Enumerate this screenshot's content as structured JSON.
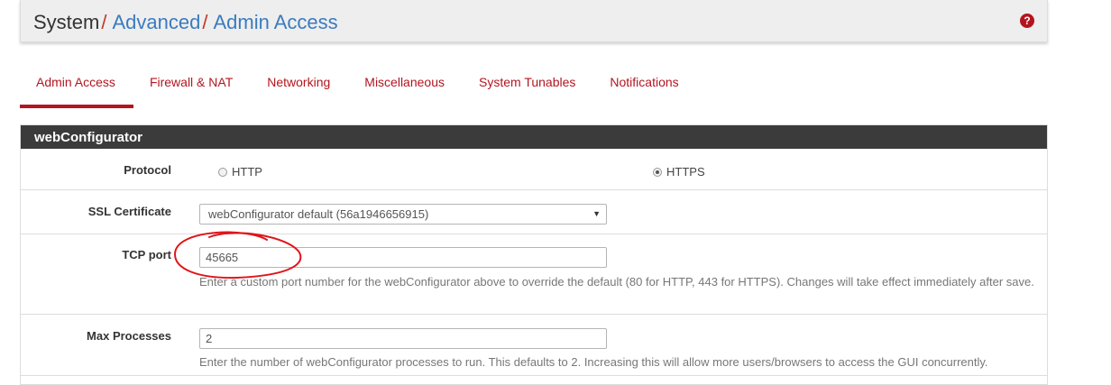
{
  "breadcrumb": {
    "system": "System",
    "advanced": "Advanced",
    "admin_access": "Admin Access",
    "separator": "/"
  },
  "help_icon": {
    "glyph": "?",
    "color": "#b3151f"
  },
  "tabs": [
    {
      "label": "Admin Access",
      "active": true
    },
    {
      "label": "Firewall & NAT",
      "active": false
    },
    {
      "label": "Networking",
      "active": false
    },
    {
      "label": "Miscellaneous",
      "active": false
    },
    {
      "label": "System Tunables",
      "active": false
    },
    {
      "label": "Notifications",
      "active": false
    }
  ],
  "panel": {
    "title": "webConfigurator",
    "protocol": {
      "label": "Protocol",
      "options": [
        {
          "label": "HTTP",
          "checked": false
        },
        {
          "label": "HTTPS",
          "checked": true
        }
      ]
    },
    "ssl_certificate": {
      "label": "SSL Certificate",
      "selected": "webConfigurator default (56a1946656915)"
    },
    "tcp_port": {
      "label": "TCP port",
      "value": "45665",
      "help": "Enter a custom port number for the webConfigurator above to override the default (80 for HTTP, 443 for HTTPS). Changes will take effect immediately after save."
    },
    "max_processes": {
      "label": "Max Processes",
      "value": "2",
      "help": "Enter the number of webConfigurator processes to run. This defaults to 2. Increasing this will allow more users/browsers to access the GUI concurrently."
    }
  },
  "colors": {
    "accent_red": "#b3151f",
    "link_blue": "#3b7bbf",
    "panel_heading_bg": "#3b3b3b",
    "annotation_red": "#e0151c"
  }
}
